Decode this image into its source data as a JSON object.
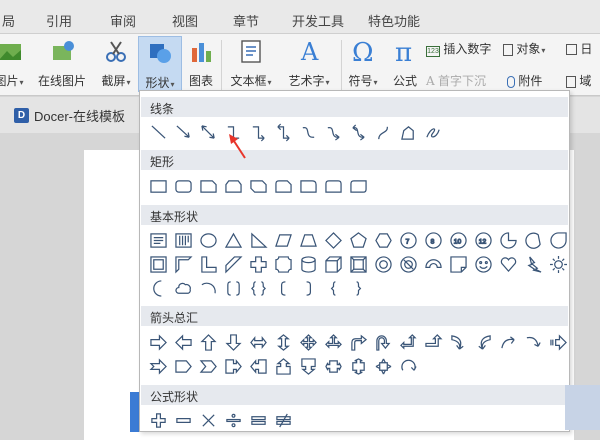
{
  "menu_tabs": [
    "局",
    "引用",
    "审阅",
    "视图",
    "章节",
    "开发工具",
    "特色功能"
  ],
  "ribbon": {
    "picture": "图片",
    "online_picture": "在线图片",
    "screenshot": "截屏",
    "shape": "形状",
    "chart": "图表",
    "textbox": "文本框",
    "art_text": "艺术字",
    "symbol": "符号",
    "formula": "公式",
    "insert_number": "插入数字",
    "object": "对象",
    "drop_cap": "首字下沉",
    "attachment": "附件",
    "date_partial": "日",
    "field_partial": "域"
  },
  "doc_tab": "Docer-在线模板",
  "popup": {
    "sections": [
      {
        "title": "线条",
        "shapes": [
          "line",
          "arrow-line",
          "double-arrow-line",
          "elbow-connector",
          "elbow-arrow-connector",
          "elbow-double-arrow-connector",
          "curved-connector",
          "curved-arrow-connector",
          "curved-double-arrow-connector",
          "curve",
          "freeform",
          "scribble"
        ]
      },
      {
        "title": "矩形",
        "shapes": [
          "rectangle",
          "rounded-rectangle",
          "snip-single-corner",
          "snip-same-side",
          "snip-diagonal",
          "snip-round",
          "round-single-corner",
          "round-same-side",
          "round-diagonal"
        ]
      },
      {
        "title": "基本形状",
        "shapes": [
          "text-box",
          "vertical-text-box",
          "oval",
          "triangle",
          "right-triangle",
          "parallelogram",
          "trapezoid",
          "diamond",
          "pentagon",
          "hexagon",
          "heptagon",
          "octagon",
          "decagon",
          "dodecagon",
          "pie",
          "chord",
          "teardrop",
          "frame",
          "half-frame",
          "l-shape",
          "diagonal-stripe",
          "cross",
          "plaque",
          "can",
          "cube",
          "bevel",
          "donut",
          "no-symbol",
          "block-arc",
          "folded-corner",
          "smiley",
          "heart",
          "lightning",
          "sun",
          "moon",
          "cloud",
          "arc",
          "double-bracket",
          "double-brace",
          "left-bracket",
          "right-bracket",
          "left-brace",
          "right-brace"
        ]
      },
      {
        "title": "箭头总汇",
        "shapes": [
          "right-arrow",
          "left-arrow",
          "up-arrow",
          "down-arrow",
          "left-right-arrow",
          "up-down-arrow",
          "quad-arrow",
          "left-right-up-arrow",
          "bent-arrow",
          "u-turn-arrow",
          "left-up-arrow",
          "bent-up-arrow",
          "curved-right-arrow",
          "curved-left-arrow",
          "curved-up-arrow",
          "curved-down-arrow",
          "striped-right-arrow",
          "notched-right-arrow",
          "pentagon-arrow",
          "chevron",
          "right-arrow-callout",
          "left-arrow-callout",
          "up-arrow-callout",
          "down-arrow-callout",
          "left-right-arrow-callout",
          "up-down-arrow-callout",
          "quad-arrow-callout",
          "circular-arrow"
        ]
      },
      {
        "title": "公式形状",
        "shapes": [
          "plus",
          "minus",
          "multiply",
          "divide",
          "equal",
          "not-equal"
        ]
      }
    ]
  },
  "accent": {
    "selected_button": "#c5daf2",
    "arrow_annotation": "#e8352b",
    "doc_blue": "#3b7bd4"
  }
}
